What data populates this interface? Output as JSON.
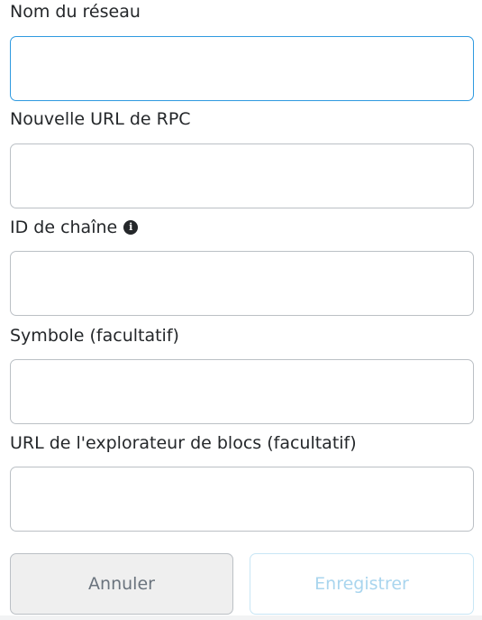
{
  "fields": [
    {
      "label": "Nom du réseau",
      "value": "",
      "focused": true
    },
    {
      "label": "Nouvelle URL de RPC",
      "value": ""
    },
    {
      "label": "ID de chaîne",
      "value": "",
      "info_icon": "info-icon"
    },
    {
      "label": "Symbole (facultatif)",
      "value": ""
    },
    {
      "label": "URL de l'explorateur de blocs (facultatif)",
      "value": ""
    }
  ],
  "buttons": {
    "cancel_label": "Annuler",
    "save_label": "Enregistrer"
  },
  "colors": {
    "focus_border": "#2f9ae0",
    "input_border": "#bbc0c5",
    "cancel_bg": "#efefef",
    "save_text_disabled": "#a9d5ee"
  }
}
